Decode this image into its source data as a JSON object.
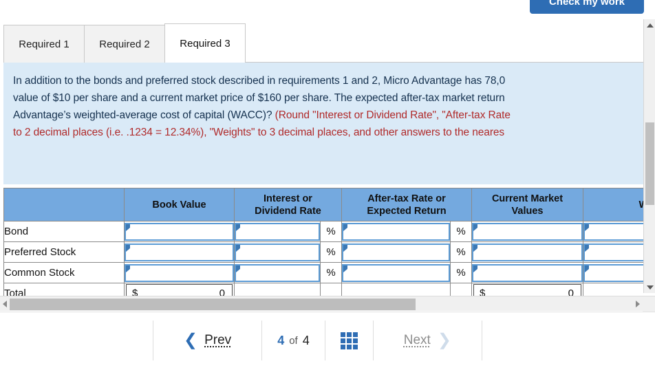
{
  "toolbar": {
    "check_my_work_label": "Check my work"
  },
  "tabs": [
    {
      "label": "Required 1",
      "active": false
    },
    {
      "label": "Required 2",
      "active": false
    },
    {
      "label": "Required 3",
      "active": true
    }
  ],
  "question": {
    "lines": [
      {
        "text": "In addition to the bonds and preferred stock described in requirements 1 and 2, Micro Advantage has 78,0",
        "color": "dark"
      },
      {
        "text": "value of $10 per share and a current market price of $160 per share. The expected after-tax market return",
        "color": "dark"
      },
      {
        "text": "Advantage’s weighted-average cost of capital (WACC)?",
        "color": "dark",
        "tail": " (Round \"Interest or Dividend Rate\", \"After-tax Rate",
        "tail_color": "red"
      },
      {
        "text": "to 2 decimal places (i.e. .1234 = 12.34%), \"Weights\" to 3 decimal places, and other answers to the neares",
        "color": "red"
      }
    ]
  },
  "table": {
    "headers": [
      "",
      "Book Value",
      "Interest or\nDividend Rate",
      "",
      "After-tax Rate or\nExpected Return",
      "",
      "Current Market\nValues",
      "Weights"
    ],
    "header_book_value": "Book Value",
    "header_interest_l1": "Interest or",
    "header_interest_l2": "Dividend Rate",
    "header_aftertax_l1": "After-tax Rate or",
    "header_aftertax_l2": "Expected Return",
    "header_market_l1": "Current Market",
    "header_market_l2": "Values",
    "header_weights": "Weights",
    "percent_symbol": "%",
    "rows": [
      {
        "label": "Bond",
        "book_value": "",
        "rate": "",
        "aftertax": "",
        "market": "",
        "weight": ""
      },
      {
        "label": "Preferred Stock",
        "book_value": "",
        "rate": "",
        "aftertax": "",
        "market": "",
        "weight": ""
      },
      {
        "label": "Common Stock",
        "book_value": "",
        "rate": "",
        "aftertax": "",
        "market": "",
        "weight": ""
      }
    ],
    "total": {
      "label": "Total",
      "currency": "$",
      "book_value": "0",
      "market_currency": "$",
      "market_value": "0"
    }
  },
  "footer_buttons": {
    "primary_label": "",
    "secondary_label": ""
  },
  "nav": {
    "prev_label": "Prev",
    "next_label": "Next",
    "current_page": "4",
    "of_label": "of",
    "total_pages": "4",
    "prev_icon": "chevron-left-icon",
    "next_icon": "chevron-right-icon",
    "grid_icon": "grid-view-icon"
  },
  "colors": {
    "accent": "#2E6DB4",
    "table_header": "#74A9DF",
    "question_bg": "#DAEAF7",
    "warning_text": "#B02A2A",
    "input_border": "#5B9BD5"
  }
}
